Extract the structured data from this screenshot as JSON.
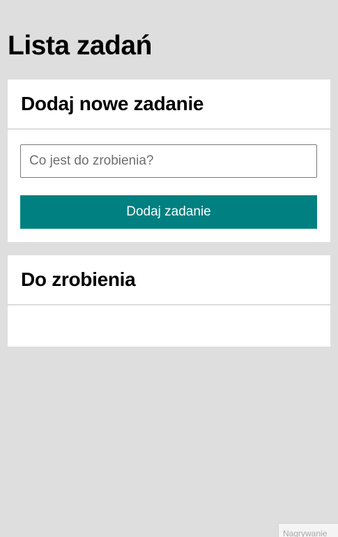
{
  "page": {
    "title": "Lista zadań"
  },
  "add_task": {
    "heading": "Dodaj nowe zadanie",
    "input_value": "",
    "input_placeholder": "Co jest do zrobienia?",
    "button_label": "Dodaj zadanie"
  },
  "todo": {
    "heading": "Do zrobienia",
    "items": []
  },
  "recording_badge": {
    "label": "Nagrywanie"
  },
  "colors": {
    "background": "#dedede",
    "card": "#ffffff",
    "accent": "#008080",
    "divider": "#dcdcdc"
  }
}
